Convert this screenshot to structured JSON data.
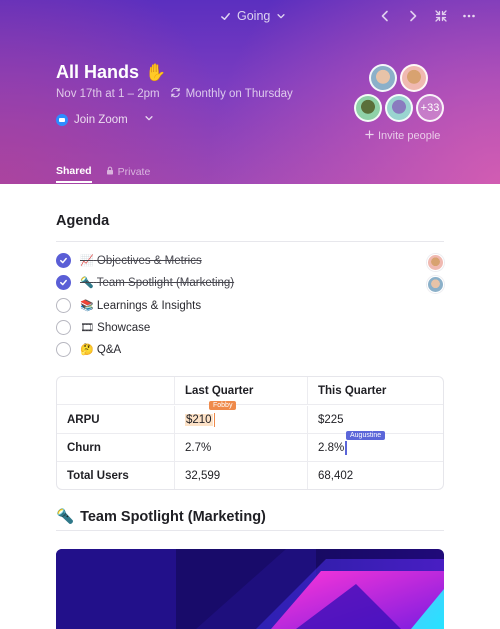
{
  "header": {
    "status_label": "Going",
    "title": "All Hands",
    "title_emoji": "✋",
    "date_time": "Nov 17th at 1 – 2pm",
    "recurrence": "Monthly on Thursday",
    "zoom_label": "Join Zoom",
    "more_attendees": "+33",
    "invite_label": "Invite people",
    "tabs": [
      {
        "label": "Shared",
        "active": true
      },
      {
        "label": "Private",
        "active": false
      }
    ]
  },
  "agenda": {
    "heading": "Agenda",
    "items": [
      {
        "emoji": "📈",
        "label": "Objectives & Metrics",
        "done": true
      },
      {
        "emoji": "🔦",
        "label": "Team Spotlight (Marketing)",
        "done": true
      },
      {
        "emoji": "📚",
        "label": "Learnings & Insights",
        "done": false
      },
      {
        "emoji": "🎞",
        "label": "Showcase",
        "done": false
      },
      {
        "emoji": "🤔",
        "label": "Q&A",
        "done": false
      }
    ]
  },
  "metrics_table": {
    "columns": [
      "",
      "Last Quarter",
      "This Quarter"
    ],
    "rows": [
      {
        "metric": "ARPU",
        "last": "$210",
        "this": "$225"
      },
      {
        "metric": "Churn",
        "last": "2.7%",
        "this": "2.8%"
      },
      {
        "metric": "Total Users",
        "last": "32,599",
        "this": "68,402"
      }
    ],
    "cursors": [
      {
        "name": "Fobby",
        "color": "#ef8a4a"
      },
      {
        "name": "Augustine",
        "color": "#5b66d9"
      }
    ]
  },
  "spotlight": {
    "emoji": "🔦",
    "heading": "Team Spotlight (Marketing)"
  },
  "colors": {
    "accent": "#5a5ed6",
    "header_top": "#5b2fbf",
    "header_bottom": "#db60b2"
  }
}
